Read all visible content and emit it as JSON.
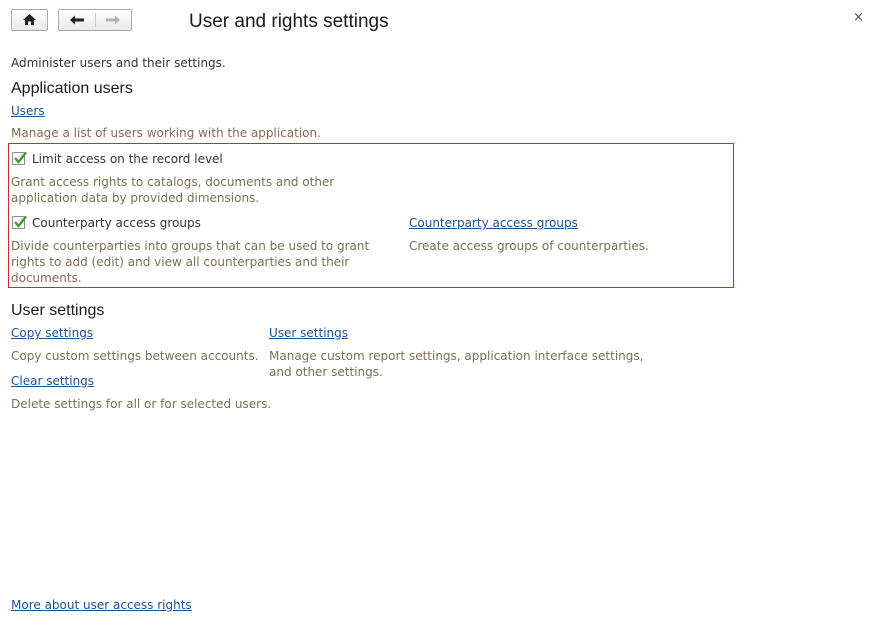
{
  "header": {
    "title": "User and rights settings",
    "home_icon": "home-icon",
    "back_icon": "arrow-left-icon",
    "forward_icon": "arrow-right-icon",
    "close_icon": "close-icon",
    "close_glyph": "×"
  },
  "intro": "Administer users and their settings.",
  "application_users": {
    "title": "Application users",
    "users_link": "Users",
    "users_desc": "Manage a list of users working with the application.",
    "limit_access": {
      "label": "Limit access on the record level",
      "checked": true,
      "desc": "Grant access rights to catalogs, documents and other application data by provided dimensions."
    },
    "counterparty_groups": {
      "label": "Counterparty access groups",
      "checked": true,
      "desc": "Divide counterparties into groups that can be used to grant rights to add (edit) and view all counterparties and their documents.",
      "link": "Counterparty access groups",
      "link_desc": "Create access groups of counterparties."
    }
  },
  "user_settings": {
    "title": "User settings",
    "copy_link": "Copy settings",
    "copy_desc": "Copy custom settings between accounts.",
    "user_settings_link": "User settings",
    "user_settings_desc": "Manage custom report settings, application interface settings, and other settings.",
    "clear_link": "Clear settings",
    "clear_desc": "Delete settings for all or for selected users."
  },
  "footer_link": "More about user access rights",
  "colors": {
    "link": "#1f4f8f",
    "description": "#7b7055",
    "highlight_border": "#d9252c",
    "checkmark": "#3c9a2e"
  }
}
